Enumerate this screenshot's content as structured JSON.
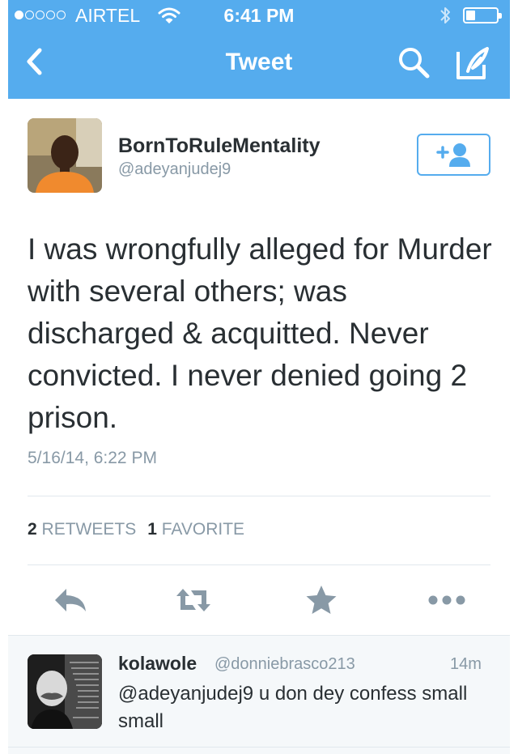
{
  "status_bar": {
    "signal_dots_filled": 1,
    "signal_dots_total": 5,
    "carrier": "AIRTEL",
    "time": "6:41 PM",
    "icons": [
      "wifi-icon",
      "bluetooth-icon",
      "battery-icon"
    ],
    "battery_level": 0.3
  },
  "nav": {
    "title": "Tweet",
    "icons": [
      "back-chevron-icon",
      "search-icon",
      "compose-icon"
    ]
  },
  "tweet": {
    "display_name": "BornToRuleMentality",
    "handle": "@adeyanjudej9",
    "text": "I was wrongfully alleged for Murder with several others; was discharged & acquitted. Never convicted. I never denied going 2 prison.",
    "timestamp": "5/16/14, 6:22 PM",
    "retweets_count": "2",
    "retweets_label": "RETWEETS",
    "favorites_count": "1",
    "favorites_label": "FAVORITE",
    "follow_icon": "add-user-icon",
    "actions": [
      "reply-icon",
      "retweet-icon",
      "favorite-star-icon",
      "more-dots-icon"
    ]
  },
  "reply": {
    "display_name": "kolawole",
    "handle": "@donniebrasco213",
    "time": "14m",
    "text": "@adeyanjudej9 u don dey confess small small"
  },
  "colors": {
    "brand_blue": "#55acee",
    "text_dark": "#292f33",
    "text_grey": "#8899a6",
    "action_grey": "#8899a6"
  }
}
